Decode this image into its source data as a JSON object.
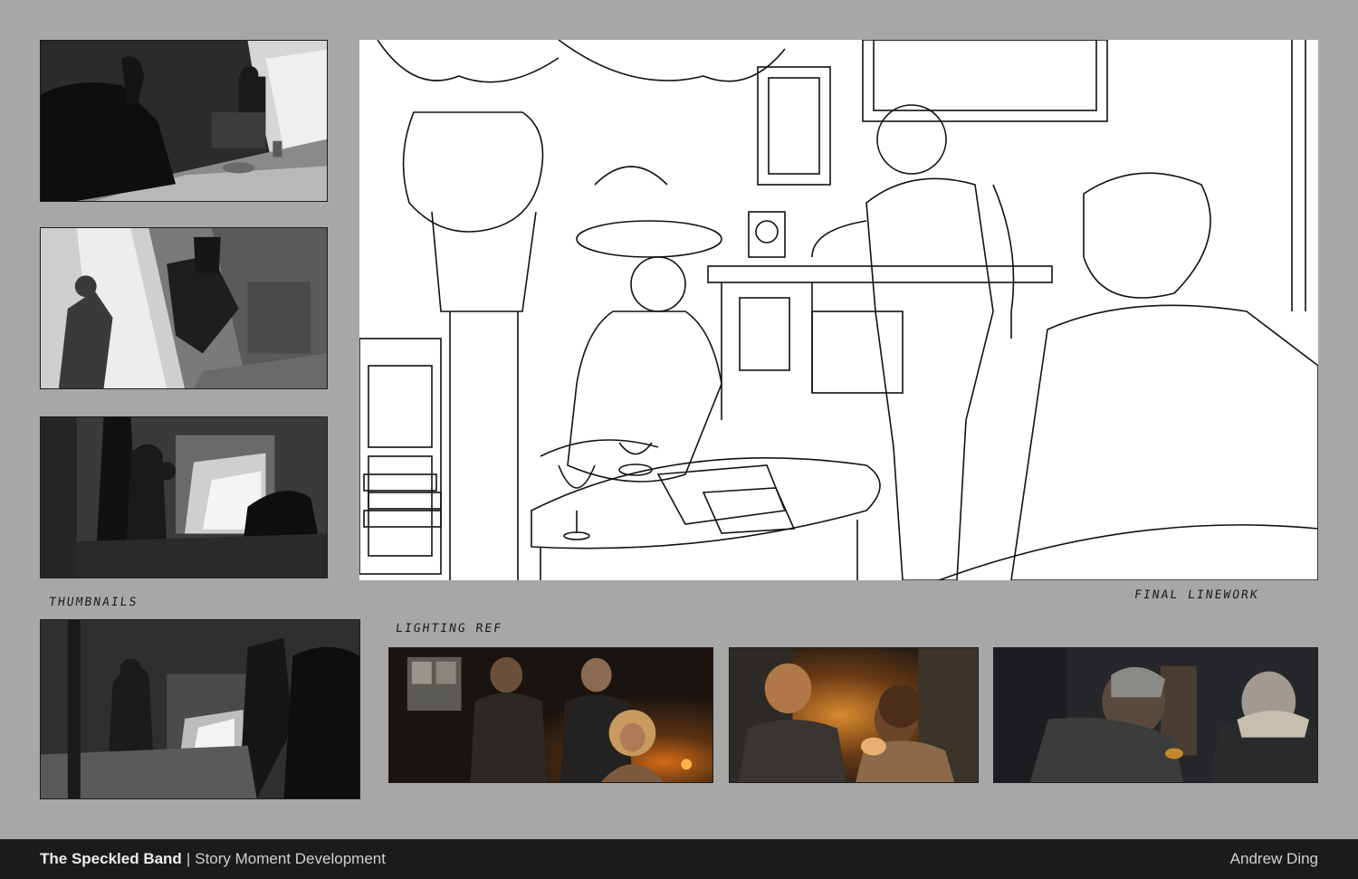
{
  "labels": {
    "thumbnails": "THUMBNAILS",
    "lighting_ref": "LIGHTING REF",
    "final_linework": "FINAL LINEWORK"
  },
  "footer": {
    "title": "The Speckled Band",
    "separator": "|",
    "subtitle": "Story Moment Development",
    "author": "Andrew Ding"
  },
  "colors": {
    "background": "#a7a7a7",
    "footer_bg": "#1b1b1b",
    "footer_text": "#d9d9d9"
  }
}
